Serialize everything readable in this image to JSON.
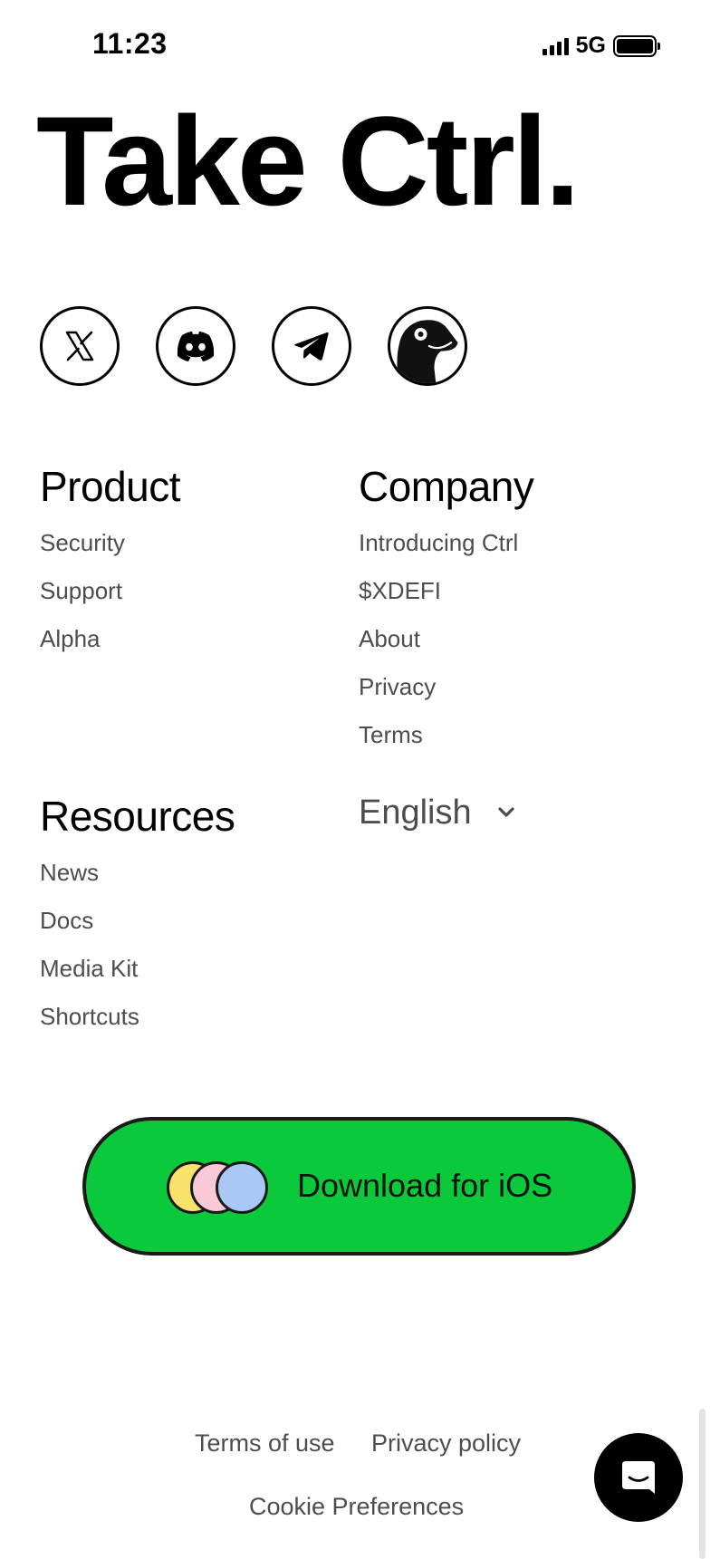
{
  "status_bar": {
    "time": "11:23",
    "network": "5G"
  },
  "hero": {
    "title": "Take Ctrl."
  },
  "social": [
    {
      "name": "x-icon"
    },
    {
      "name": "discord-icon"
    },
    {
      "name": "telegram-icon"
    },
    {
      "name": "coingecko-icon"
    }
  ],
  "product": {
    "heading": "Product",
    "links": [
      "Security",
      "Support",
      "Alpha"
    ]
  },
  "company": {
    "heading": "Company",
    "links": [
      "Introducing Ctrl",
      "$XDEFI",
      "About",
      "Privacy",
      "Terms"
    ]
  },
  "resources": {
    "heading": "Resources",
    "links": [
      "News",
      "Docs",
      "Media Kit",
      "Shortcuts"
    ]
  },
  "language": {
    "selected": "English",
    "icon": "chevron-down-icon"
  },
  "download": {
    "label": "Download for iOS",
    "dot_colors": [
      "#f7e26b",
      "#f9c9d8",
      "#a9c8f5"
    ],
    "button_color": "#0ac93a"
  },
  "footer": {
    "terms_of_use": "Terms of use",
    "privacy_policy": "Privacy policy",
    "cookie_preferences": "Cookie Preferences"
  },
  "chat": {
    "icon": "chat-icon"
  }
}
